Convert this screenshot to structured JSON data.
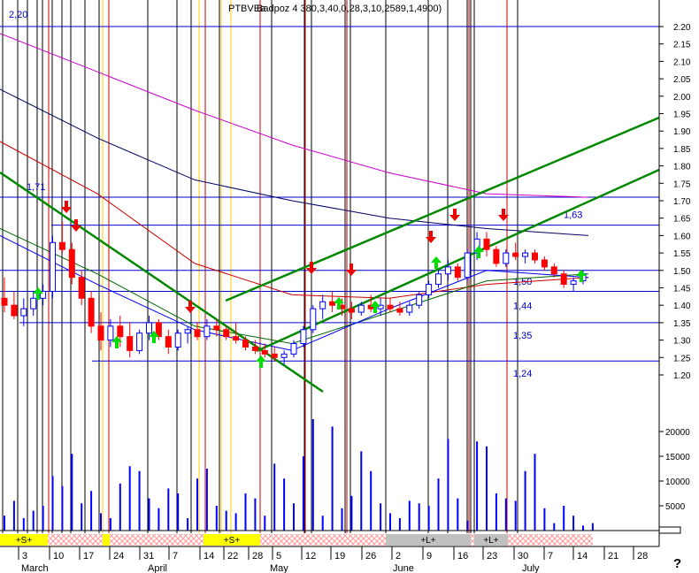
{
  "header": {
    "title": "PTBVEa",
    "overlay": "Badpoz 4 380,3,40,0,28,3,10,2589,1,4900)"
  },
  "corner_labels": {
    "top_left": "2,20",
    "help": "?"
  },
  "colors": {
    "background": "#ffffff",
    "grid": "#000000",
    "horizontal_level": "#0000cc",
    "red_marker": "#cc0000",
    "yellow_marker": "#ffcc00",
    "up_candle": "#0000ff",
    "down_candle": "#ff0000",
    "volume": "#0000ff",
    "trend_line": "#008800",
    "ma_magenta": "#cc00cc",
    "ma_navy": "#000066",
    "ma_red": "#cc0000",
    "ma_green": "#006600",
    "ma_blue": "#0000ff",
    "arrow_up": "#00dd00",
    "arrow_down": "#ee0000",
    "signal_yellow": "#ffff00",
    "signal_grey": "#c0c0c0",
    "signal_hatch": "#ff9999"
  },
  "chart_data": {
    "type": "candlestick",
    "price_axis": {
      "ticks": [
        "2.20",
        "2.15",
        "2.10",
        "2.05",
        "2.00",
        "1.95",
        "1.90",
        "1.85",
        "1.80",
        "1.75",
        "1.70",
        "1.65",
        "1.60",
        "1.55",
        "1.50",
        "1.45",
        "1.40",
        "1.35",
        "1.30",
        "1.25",
        "1.20"
      ],
      "range": [
        1.2,
        2.2
      ]
    },
    "volume_axis": {
      "ticks": [
        "20000",
        "15000",
        "10000",
        "5000"
      ],
      "range": [
        0,
        25000
      ]
    },
    "x_axis": {
      "labels": [
        "3",
        "10",
        "17",
        "24",
        "31",
        "7",
        "14",
        "22",
        "28",
        "5",
        "12",
        "19",
        "26",
        "2",
        "9",
        "16",
        "23",
        "30",
        "7",
        "14",
        "21",
        "28"
      ],
      "months": [
        "March",
        "April",
        "May",
        "June",
        "July"
      ]
    },
    "horizontal_levels": [
      {
        "label": "1,71",
        "value": 1.71
      },
      {
        "label": "1,63",
        "value": 1.63
      },
      {
        "label": "1,50",
        "value": 1.5
      },
      {
        "label": "1,44",
        "value": 1.44
      },
      {
        "label": "1,35",
        "value": 1.35
      },
      {
        "label": "1,24",
        "value": 1.24
      }
    ],
    "signals": [
      "+S+",
      "+S+",
      "+S+",
      "+L+",
      "+L+"
    ],
    "series": [
      {
        "kind": "ohlc",
        "values": [
          [
            1.42,
            1.48,
            1.38,
            1.4
          ],
          [
            1.4,
            1.44,
            1.36,
            1.37
          ],
          [
            1.37,
            1.42,
            1.34,
            1.39
          ],
          [
            1.39,
            1.44,
            1.37,
            1.42
          ],
          [
            1.42,
            1.46,
            1.4,
            1.44
          ],
          [
            1.44,
            1.6,
            1.42,
            1.58
          ],
          [
            1.58,
            1.64,
            1.55,
            1.56
          ],
          [
            1.56,
            1.58,
            1.46,
            1.48
          ],
          [
            1.48,
            1.5,
            1.4,
            1.42
          ],
          [
            1.42,
            1.44,
            1.32,
            1.34
          ],
          [
            1.34,
            1.38,
            1.27,
            1.3
          ],
          [
            1.3,
            1.36,
            1.28,
            1.34
          ],
          [
            1.34,
            1.37,
            1.28,
            1.31
          ],
          [
            1.31,
            1.35,
            1.25,
            1.27
          ],
          [
            1.27,
            1.33,
            1.26,
            1.32
          ],
          [
            1.32,
            1.37,
            1.3,
            1.35
          ],
          [
            1.35,
            1.36,
            1.3,
            1.31
          ],
          [
            1.31,
            1.33,
            1.26,
            1.28
          ],
          [
            1.28,
            1.33,
            1.27,
            1.32
          ],
          [
            1.32,
            1.34,
            1.29,
            1.33
          ],
          [
            1.33,
            1.35,
            1.3,
            1.31
          ],
          [
            1.31,
            1.36,
            1.3,
            1.34
          ],
          [
            1.34,
            1.36,
            1.31,
            1.33
          ],
          [
            1.33,
            1.34,
            1.3,
            1.31
          ],
          [
            1.31,
            1.35,
            1.29,
            1.3
          ],
          [
            1.3,
            1.31,
            1.27,
            1.28
          ],
          [
            1.28,
            1.3,
            1.26,
            1.27
          ],
          [
            1.27,
            1.29,
            1.25,
            1.26
          ],
          [
            1.26,
            1.28,
            1.24,
            1.25
          ],
          [
            1.25,
            1.27,
            1.23,
            1.26
          ],
          [
            1.26,
            1.3,
            1.25,
            1.29
          ],
          [
            1.29,
            1.34,
            1.28,
            1.33
          ],
          [
            1.33,
            1.4,
            1.32,
            1.39
          ],
          [
            1.39,
            1.43,
            1.36,
            1.41
          ],
          [
            1.41,
            1.44,
            1.38,
            1.4
          ],
          [
            1.4,
            1.42,
            1.37,
            1.39
          ],
          [
            1.39,
            1.41,
            1.36,
            1.38
          ],
          [
            1.38,
            1.41,
            1.37,
            1.4
          ],
          [
            1.4,
            1.43,
            1.38,
            1.39
          ],
          [
            1.39,
            1.42,
            1.37,
            1.4
          ],
          [
            1.4,
            1.42,
            1.38,
            1.39
          ],
          [
            1.39,
            1.41,
            1.37,
            1.38
          ],
          [
            1.38,
            1.41,
            1.37,
            1.4
          ],
          [
            1.4,
            1.44,
            1.39,
            1.43
          ],
          [
            1.43,
            1.47,
            1.42,
            1.46
          ],
          [
            1.46,
            1.5,
            1.45,
            1.49
          ],
          [
            1.49,
            1.53,
            1.47,
            1.51
          ],
          [
            1.51,
            1.52,
            1.47,
            1.48
          ],
          [
            1.48,
            1.56,
            1.47,
            1.55
          ],
          [
            1.55,
            1.61,
            1.53,
            1.59
          ],
          [
            1.59,
            1.61,
            1.54,
            1.56
          ],
          [
            1.56,
            1.57,
            1.51,
            1.52
          ],
          [
            1.52,
            1.56,
            1.51,
            1.55
          ],
          [
            1.55,
            1.58,
            1.53,
            1.54
          ],
          [
            1.54,
            1.56,
            1.52,
            1.55
          ],
          [
            1.55,
            1.56,
            1.52,
            1.53
          ],
          [
            1.53,
            1.54,
            1.5,
            1.51
          ],
          [
            1.51,
            1.52,
            1.48,
            1.49
          ],
          [
            1.49,
            1.5,
            1.45,
            1.46
          ],
          [
            1.46,
            1.48,
            1.44,
            1.47
          ],
          [
            1.47,
            1.5,
            1.46,
            1.49
          ]
        ]
      },
      {
        "kind": "volume",
        "values": [
          3000,
          6000,
          2500,
          4000,
          5000,
          11000,
          9000,
          15500,
          5500,
          8000,
          3500,
          2500,
          9500,
          13000,
          12000,
          6500,
          4500,
          8500,
          7500,
          2500,
          10500,
          12500,
          5000,
          4000,
          3500,
          7500,
          6500,
          3000,
          13500,
          10500,
          5500,
          15000,
          22500,
          3000,
          21000,
          4500,
          7000,
          16000,
          12000,
          5500,
          3500,
          2500,
          6000,
          5500,
          5000,
          10500,
          18500,
          6500,
          2000,
          18000,
          17000,
          7500,
          6500,
          6000,
          12000,
          15500,
          4500,
          1500,
          5000,
          3000,
          1000,
          1500
        ]
      }
    ],
    "moving_averages": [
      {
        "color": "magenta",
        "values": [
          2.18,
          2.07,
          1.96,
          1.86,
          1.78,
          1.72,
          1.71
        ]
      },
      {
        "color": "navy",
        "values": [
          2.02,
          1.88,
          1.76,
          1.7,
          1.65,
          1.62,
          1.6
        ]
      },
      {
        "color": "red",
        "values": [
          1.87,
          1.72,
          1.52,
          1.43,
          1.42,
          1.46,
          1.48
        ]
      },
      {
        "color": "green",
        "values": [
          1.62,
          1.49,
          1.34,
          1.29,
          1.38,
          1.47,
          1.49
        ]
      },
      {
        "color": "blue",
        "values": [
          1.6,
          1.46,
          1.33,
          1.27,
          1.39,
          1.5,
          1.48
        ]
      }
    ]
  }
}
